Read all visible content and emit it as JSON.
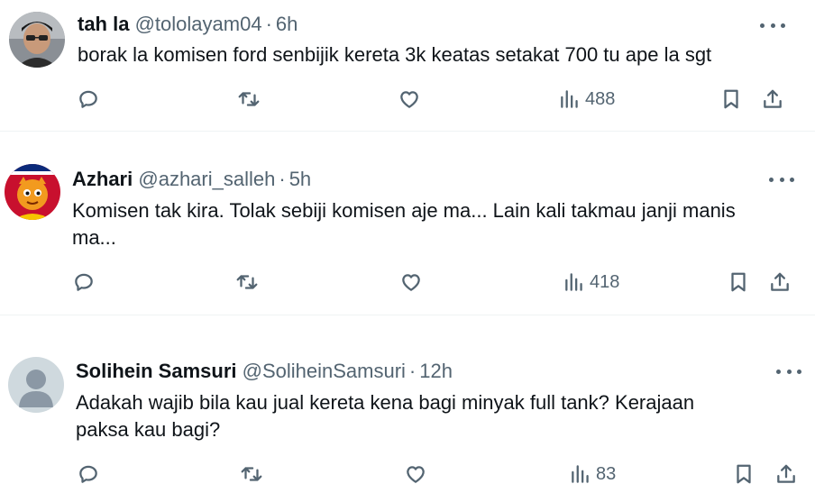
{
  "tweets": [
    {
      "name": "tah la",
      "handle": "@tololayam04",
      "separator": "·",
      "time": "6h",
      "text": "borak la komisen ford senbijik kereta 3k keatas setakat 700 tu ape la sgt",
      "views": "488",
      "avatar": "profile-photo"
    },
    {
      "name": "Azhari",
      "handle": "@azhari_salleh",
      "separator": "·",
      "time": "5h",
      "text": "Komisen tak kira. Tolak sebiji komisen aje ma... Lain kali takmau janji manis\nma...",
      "views": "418",
      "avatar": "mascot-emblem"
    },
    {
      "name": "Solihein Samsuri",
      "handle": "@SoliheinSamsuri",
      "separator": "·",
      "time": "12h",
      "text": "Adakah wajib bila kau jual kereta kena bagi minyak full tank? Kerajaan\npaksa kau bagi?",
      "views": "83",
      "avatar": "default-avatar"
    }
  ],
  "icons": {
    "reply": "reply-icon",
    "retweet": "retweet-icon",
    "like": "like-icon",
    "views": "views-icon",
    "bookmark": "bookmark-icon",
    "share": "share-icon",
    "more": "more-icon"
  },
  "colors": {
    "text": "#0f1419",
    "secondary": "#536471",
    "divider": "#eff3f4"
  }
}
